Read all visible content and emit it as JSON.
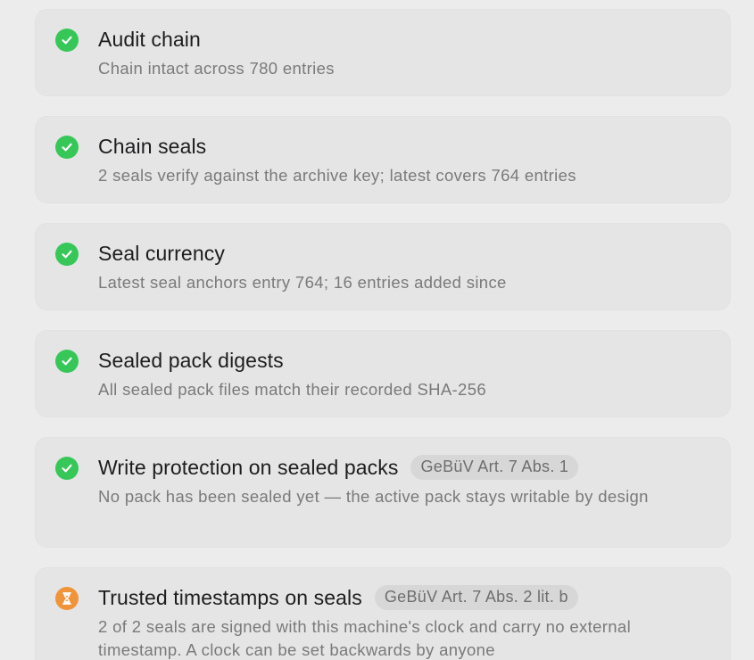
{
  "checks": [
    {
      "status": "ok",
      "icon": "checkmark-icon",
      "title": "Audit chain",
      "badge": "",
      "description": "Chain intact across 780 entries"
    },
    {
      "status": "ok",
      "icon": "checkmark-icon",
      "title": "Chain seals",
      "badge": "",
      "description": "2 seals verify against the archive key; latest covers 764 entries"
    },
    {
      "status": "ok",
      "icon": "checkmark-icon",
      "title": "Seal currency",
      "badge": "",
      "description": "Latest seal anchors entry 764; 16 entries added since"
    },
    {
      "status": "ok",
      "icon": "checkmark-icon",
      "title": "Sealed pack digests",
      "badge": "",
      "description": "All sealed pack files match their recorded SHA-256"
    },
    {
      "status": "ok",
      "icon": "checkmark-icon",
      "title": "Write protection on sealed packs",
      "badge": "GeBüV Art. 7 Abs. 1",
      "description": "No pack has been sealed yet — the active pack stays writable by design"
    },
    {
      "status": "pending",
      "icon": "hourglass-icon",
      "title": "Trusted timestamps on seals",
      "badge": "GeBüV Art. 7 Abs. 2 lit. b",
      "description": "2 of 2 seals are signed with this machine's clock and carry no external timestamp. A clock can be set backwards by anyone"
    }
  ],
  "colors": {
    "ok": "#37c759",
    "pending": "#f0943a",
    "card_bg": "#e5e5e5",
    "page_bg": "#ececec"
  }
}
